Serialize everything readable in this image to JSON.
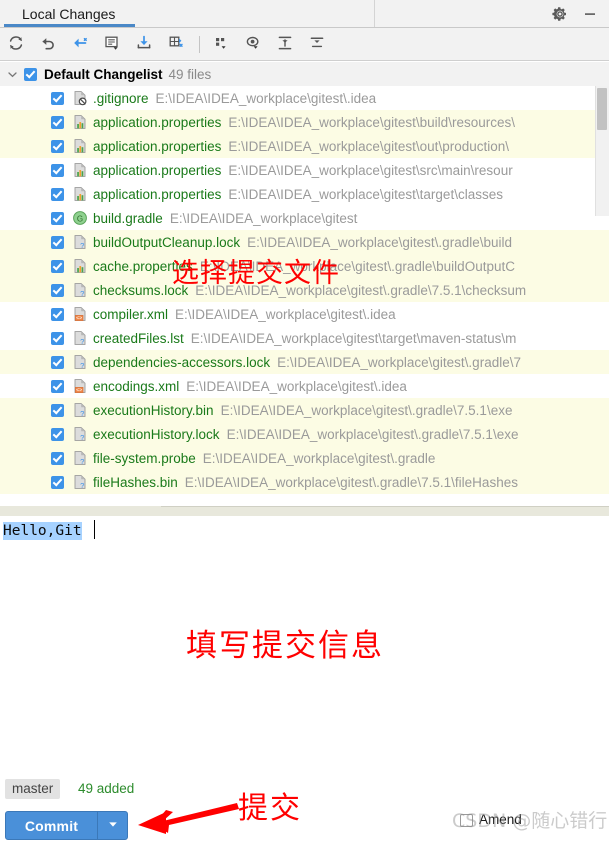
{
  "window": {
    "tab_label": "Local Changes",
    "gear_icon": "gear-icon",
    "minimize_icon": "minimize-icon"
  },
  "toolbar": {
    "buttons": [
      {
        "name": "refresh-button",
        "icon": "refresh-icon",
        "tooltip": "Refresh"
      },
      {
        "name": "rollback-button",
        "icon": "undo-arrow-icon",
        "tooltip": "Rollback"
      },
      {
        "name": "shelve-button",
        "icon": "shelve-arrow-icon",
        "tooltip": "Shelve Silently"
      },
      {
        "name": "new-changelist-button",
        "icon": "changelist-note-icon",
        "tooltip": "New Changelist"
      },
      {
        "name": "unshelve-button",
        "icon": "download-tray-icon",
        "tooltip": "Unshelve"
      },
      {
        "name": "move-to-changelist-button",
        "icon": "move-changes-icon",
        "tooltip": "Move to Another Changelist"
      },
      {
        "name": "group-by-button",
        "icon": "group-by-icon",
        "tooltip": "Group By"
      },
      {
        "name": "preview-diff-button",
        "icon": "eye-preview-icon",
        "tooltip": "Preview Diff"
      },
      {
        "name": "expand-all-button",
        "icon": "expand-all-icon",
        "tooltip": "Expand All"
      },
      {
        "name": "collapse-all-button",
        "icon": "collapse-all-icon",
        "tooltip": "Collapse All"
      }
    ]
  },
  "changelist": {
    "expand_icon": "chevron-down-icon",
    "checked": true,
    "title": "Default Changelist",
    "count_label": "49 files"
  },
  "files": [
    {
      "name": ".gitignore",
      "path": "E:\\IDEA\\IDEA_workplace\\gitest\\.idea",
      "icon": "file-ignored-icon",
      "checked": true,
      "stripe": false
    },
    {
      "name": "application.properties",
      "path": "E:\\IDEA\\IDEA_workplace\\gitest\\build\\resources\\",
      "icon": "properties-file-icon",
      "checked": true,
      "stripe": true
    },
    {
      "name": "application.properties",
      "path": "E:\\IDEA\\IDEA_workplace\\gitest\\out\\production\\",
      "icon": "properties-file-icon",
      "checked": true,
      "stripe": true
    },
    {
      "name": "application.properties",
      "path": "E:\\IDEA\\IDEA_workplace\\gitest\\src\\main\\resour",
      "icon": "properties-file-icon",
      "checked": true,
      "stripe": false
    },
    {
      "name": "application.properties",
      "path": "E:\\IDEA\\IDEA_workplace\\gitest\\target\\classes",
      "icon": "properties-file-icon",
      "checked": true,
      "stripe": false
    },
    {
      "name": "build.gradle",
      "path": "E:\\IDEA\\IDEA_workplace\\gitest",
      "icon": "gradle-file-icon",
      "checked": true,
      "stripe": false
    },
    {
      "name": "buildOutputCleanup.lock",
      "path": "E:\\IDEA\\IDEA_workplace\\gitest\\.gradle\\build",
      "icon": "unknown-file-icon",
      "checked": true,
      "stripe": true
    },
    {
      "name": "cache.properties",
      "path": "E:\\IDEA\\IDEA_workplace\\gitest\\.gradle\\buildOutputC",
      "icon": "properties-file-icon",
      "checked": true,
      "stripe": true
    },
    {
      "name": "checksums.lock",
      "path": "E:\\IDEA\\IDEA_workplace\\gitest\\.gradle\\7.5.1\\checksum",
      "icon": "unknown-file-icon",
      "checked": true,
      "stripe": true
    },
    {
      "name": "compiler.xml",
      "path": "E:\\IDEA\\IDEA_workplace\\gitest\\.idea",
      "icon": "xml-file-icon",
      "checked": true,
      "stripe": false
    },
    {
      "name": "createdFiles.lst",
      "path": "E:\\IDEA\\IDEA_workplace\\gitest\\target\\maven-status\\m",
      "icon": "unknown-file-icon",
      "checked": true,
      "stripe": false
    },
    {
      "name": "dependencies-accessors.lock",
      "path": "E:\\IDEA\\IDEA_workplace\\gitest\\.gradle\\7",
      "icon": "unknown-file-icon",
      "checked": true,
      "stripe": true
    },
    {
      "name": "encodings.xml",
      "path": "E:\\IDEA\\IDEA_workplace\\gitest\\.idea",
      "icon": "xml-file-icon",
      "checked": true,
      "stripe": false
    },
    {
      "name": "executionHistory.bin",
      "path": "E:\\IDEA\\IDEA_workplace\\gitest\\.gradle\\7.5.1\\exe",
      "icon": "unknown-file-icon",
      "checked": true,
      "stripe": true
    },
    {
      "name": "executionHistory.lock",
      "path": "E:\\IDEA\\IDEA_workplace\\gitest\\.gradle\\7.5.1\\exe",
      "icon": "unknown-file-icon",
      "checked": true,
      "stripe": true
    },
    {
      "name": "file-system.probe",
      "path": "E:\\IDEA\\IDEA_workplace\\gitest\\.gradle",
      "icon": "unknown-file-icon",
      "checked": true,
      "stripe": true
    },
    {
      "name": "fileHashes.bin",
      "path": "E:\\IDEA\\IDEA_workplace\\gitest\\.gradle\\7.5.1\\fileHashes",
      "icon": "unknown-file-icon",
      "checked": true,
      "stripe": true
    }
  ],
  "commit_message": {
    "value": "Hello,Git",
    "selected": true
  },
  "bottom": {
    "branch": "master",
    "added_label": "49 added",
    "commit_button": "Commit",
    "commit_dropdown_icon": "chevron-down-icon",
    "amend_label": "Amend",
    "amend_checked": false
  },
  "annotations": {
    "select_files": "选择提交文件",
    "fill_message": "填写提交信息",
    "commit": "提交",
    "arrow": "red-arrow-left-icon"
  },
  "watermark": "CSDN @随心错行",
  "colors": {
    "accent_blue": "#4a90d9",
    "checkbox_blue": "#3d93e8",
    "file_green": "#1a7a1a",
    "path_gray": "#9a9a9a",
    "stripe_yellow": "#fcfce4",
    "annotation_red": "#ff0000",
    "added_green": "#2d8c2d"
  }
}
